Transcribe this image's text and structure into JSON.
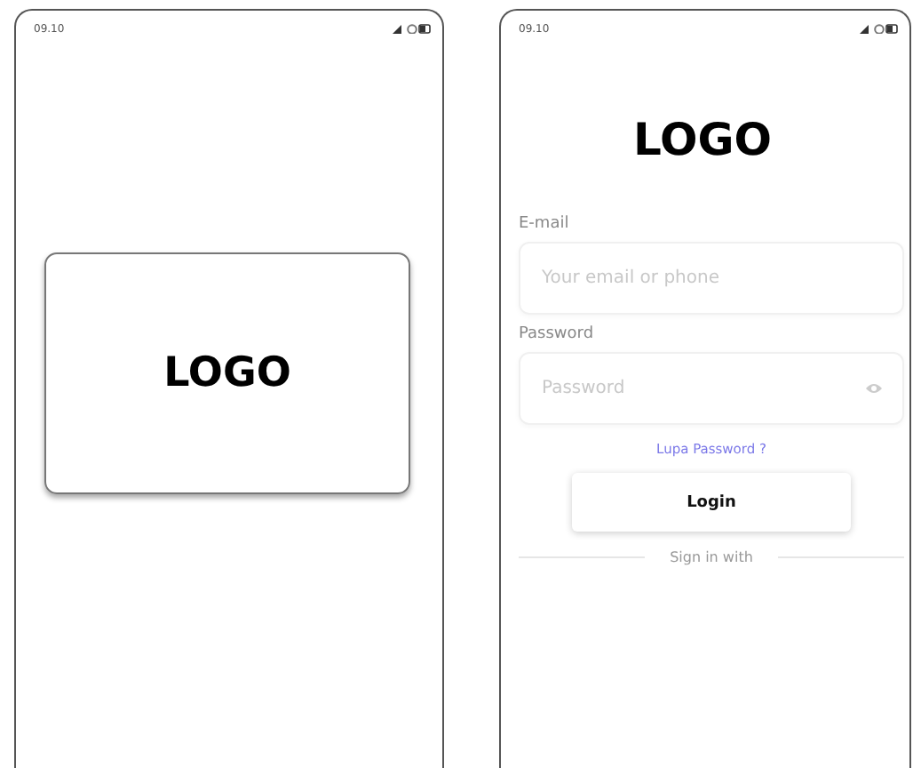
{
  "splash_screen": {
    "status_bar": {
      "time": "09.10"
    },
    "logo": "LOGO"
  },
  "login_screen": {
    "status_bar": {
      "time": "09.10"
    },
    "logo": "LOGO",
    "fields": [
      {
        "label": "E-mail",
        "placeholder": "Your email or phone",
        "kind": "text"
      },
      {
        "label": "Password",
        "placeholder": "Password",
        "kind": "password"
      }
    ],
    "forgot_link": "Lupa Password ?",
    "login_button": "Login",
    "divider_text": "Sign in with"
  }
}
